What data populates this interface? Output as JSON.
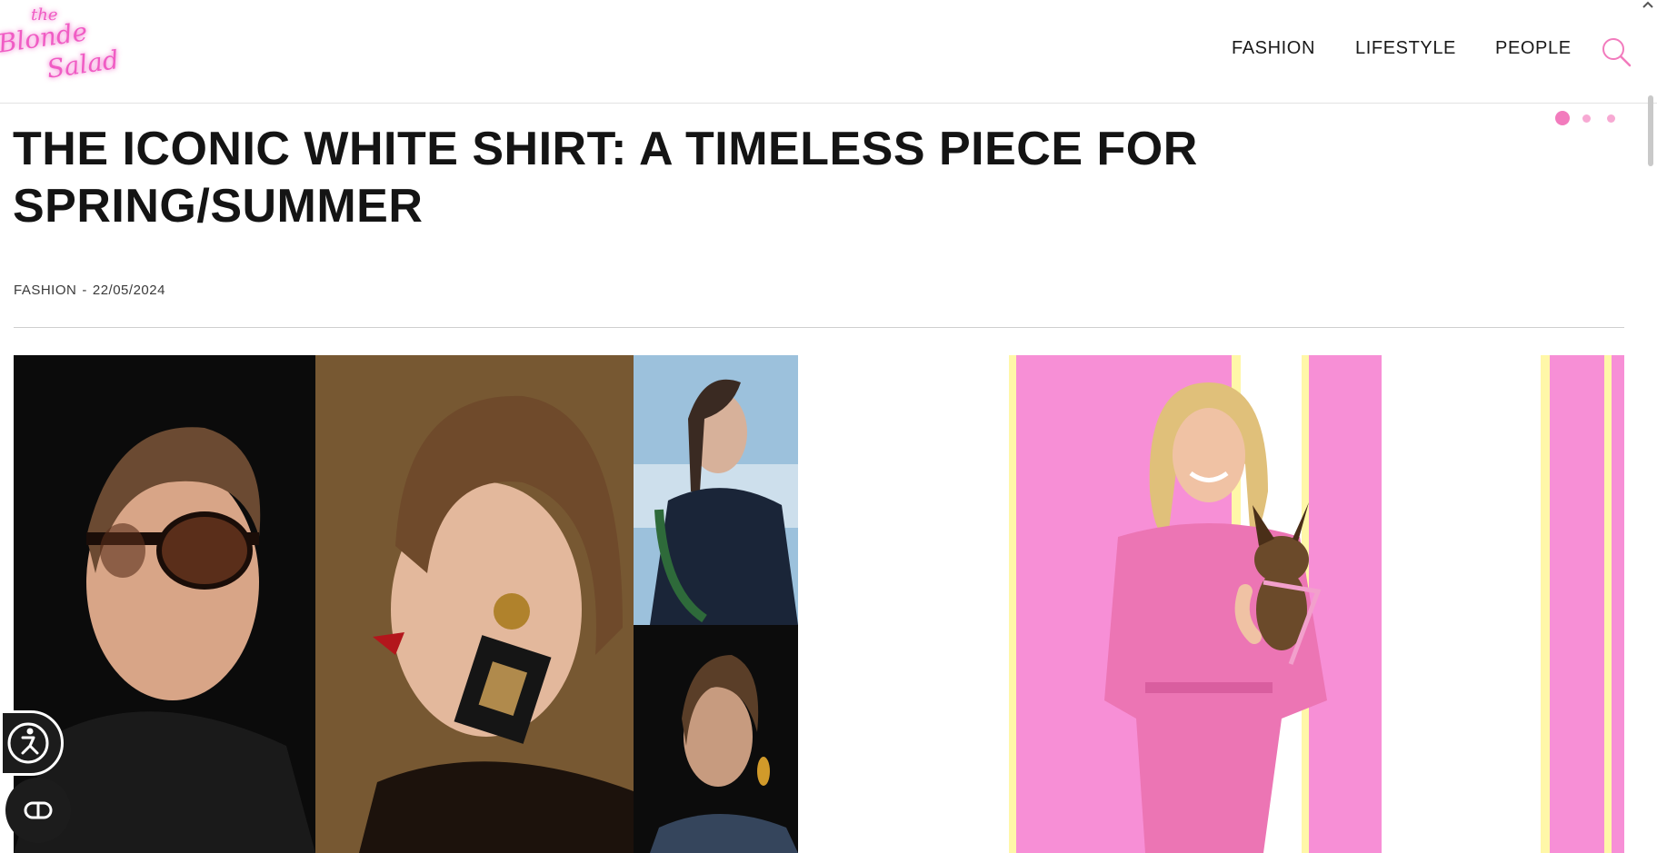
{
  "header": {
    "logo_text": [
      "the",
      "Blonde",
      "Salad"
    ],
    "nav": [
      "FASHION",
      "LIFESTYLE",
      "PEOPLE"
    ],
    "icons": [
      "search-icon"
    ]
  },
  "slider": {
    "count": 3,
    "active": 1
  },
  "article": {
    "title": "THE ICONIC WHITE SHIRT: A TIMELESS PIECE FOR SPRING/SUMMER",
    "category": "FASHION",
    "separator": "-",
    "date": "22/05/2024"
  },
  "widgets": {
    "icons": [
      "accessibility-icon",
      "cookie-consent-icon"
    ]
  },
  "colors": {
    "accent": "#f27bbd",
    "text": "#141414",
    "feature_bg": "#f78fd6"
  }
}
